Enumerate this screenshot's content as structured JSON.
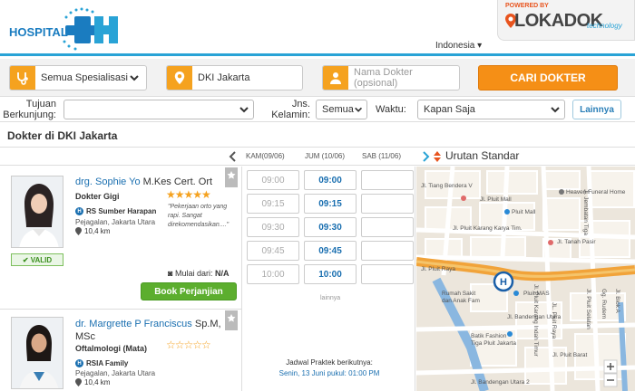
{
  "header": {
    "logo_text": "HOSPITAL",
    "powered_by": "POWERED BY",
    "brand": "LOKADOK",
    "brand_sub": "technology",
    "language": "Indonesia ▾"
  },
  "search": {
    "specialization": "Semua Spesialisasi",
    "location": "DKI Jakarta",
    "doctor_placeholder": "Nama Dokter (opsional)",
    "submit_label": "CARI DOKTER"
  },
  "filters": {
    "purpose_label_1": "Tujuan",
    "purpose_label_2": "Berkunjung:",
    "purpose_value": "",
    "gender_label_1": "Jns.",
    "gender_label_2": "Kelamin:",
    "gender_value": "Semua",
    "time_label": "Waktu:",
    "time_value": "Kapan Saja",
    "more_label": "Lainnya"
  },
  "section_title": "Dokter di DKI Jakarta",
  "schedule_header": {
    "days": [
      "KAM(09/06)",
      "JUM (10/06)",
      "SAB (11/06)"
    ],
    "sort_label": "Urutan Standar"
  },
  "doctors": [
    {
      "name": "drg. Sophie Yo",
      "title": " M.Kes Cert. Ort",
      "specialty": "Dokter Gigi",
      "rating": 5,
      "quote": "\"Pekerjaan orto yang rapi. Sangat direkomendasikan....\"",
      "hospital": "RS Sumber Harapan",
      "address": "Pejagalan, Jakarta Utara",
      "distance": "10,4 km",
      "valid_label": "VALID",
      "price_label": "Mulai dari:",
      "price_value": "N/A",
      "book_label": "Book Perjanjian",
      "slots": {
        "thu": [
          "09:00",
          "09:15",
          "09:30",
          "09:45",
          "10:00"
        ],
        "fri": [
          "09:00",
          "09:15",
          "09:30",
          "09:45",
          "10:00"
        ]
      },
      "more_slots": "lainnya"
    },
    {
      "name": "dr. Margrette P Franciscus",
      "title": " Sp.M,",
      "title2": "MSc",
      "specialty": "Oftalmologi (Mata)",
      "rating": 0,
      "hospital": "RSIA Family",
      "address": "Pejagalan, Jakarta Utara",
      "distance": "10,4 km",
      "next_schedule_label": "Jadwal Praktek berikutnya:",
      "next_schedule_value": "Senin, 13 Juni pukul: 01:00 PM"
    }
  ],
  "map": {
    "labels": [
      "Jl. Tiang Bendera V",
      "Heaven Funeral Home",
      "Jl. Pluit Mall",
      "Pluit Mall",
      "Jl. Pluit Karang Karya Tim.",
      "Jl. Tanah Pasir",
      "Jl. Jembatan Tiga",
      "Rumah Sakit",
      "dan Anak Fam",
      "Pluit MAS",
      "Jl. Bandengan Utara",
      "Batik Fashion",
      "Tiga Pluit Jakarta",
      "Jl. Bandengan Utara 2",
      "Jl. Pluit Karang Indah Timur",
      "Jl. Pluit Raya",
      "Jl. Pluit Selatan",
      "Jl. Pluit Barat",
      "Jl. Tanah Pasir",
      "Gg. Rudem",
      "Jl. Blok A",
      "JL. Pluit Raya"
    ],
    "marker": "H"
  },
  "colors": {
    "accent": "#29a3d6",
    "orange": "#f58f16",
    "green": "#5cae2e",
    "link": "#1a6fb0"
  }
}
